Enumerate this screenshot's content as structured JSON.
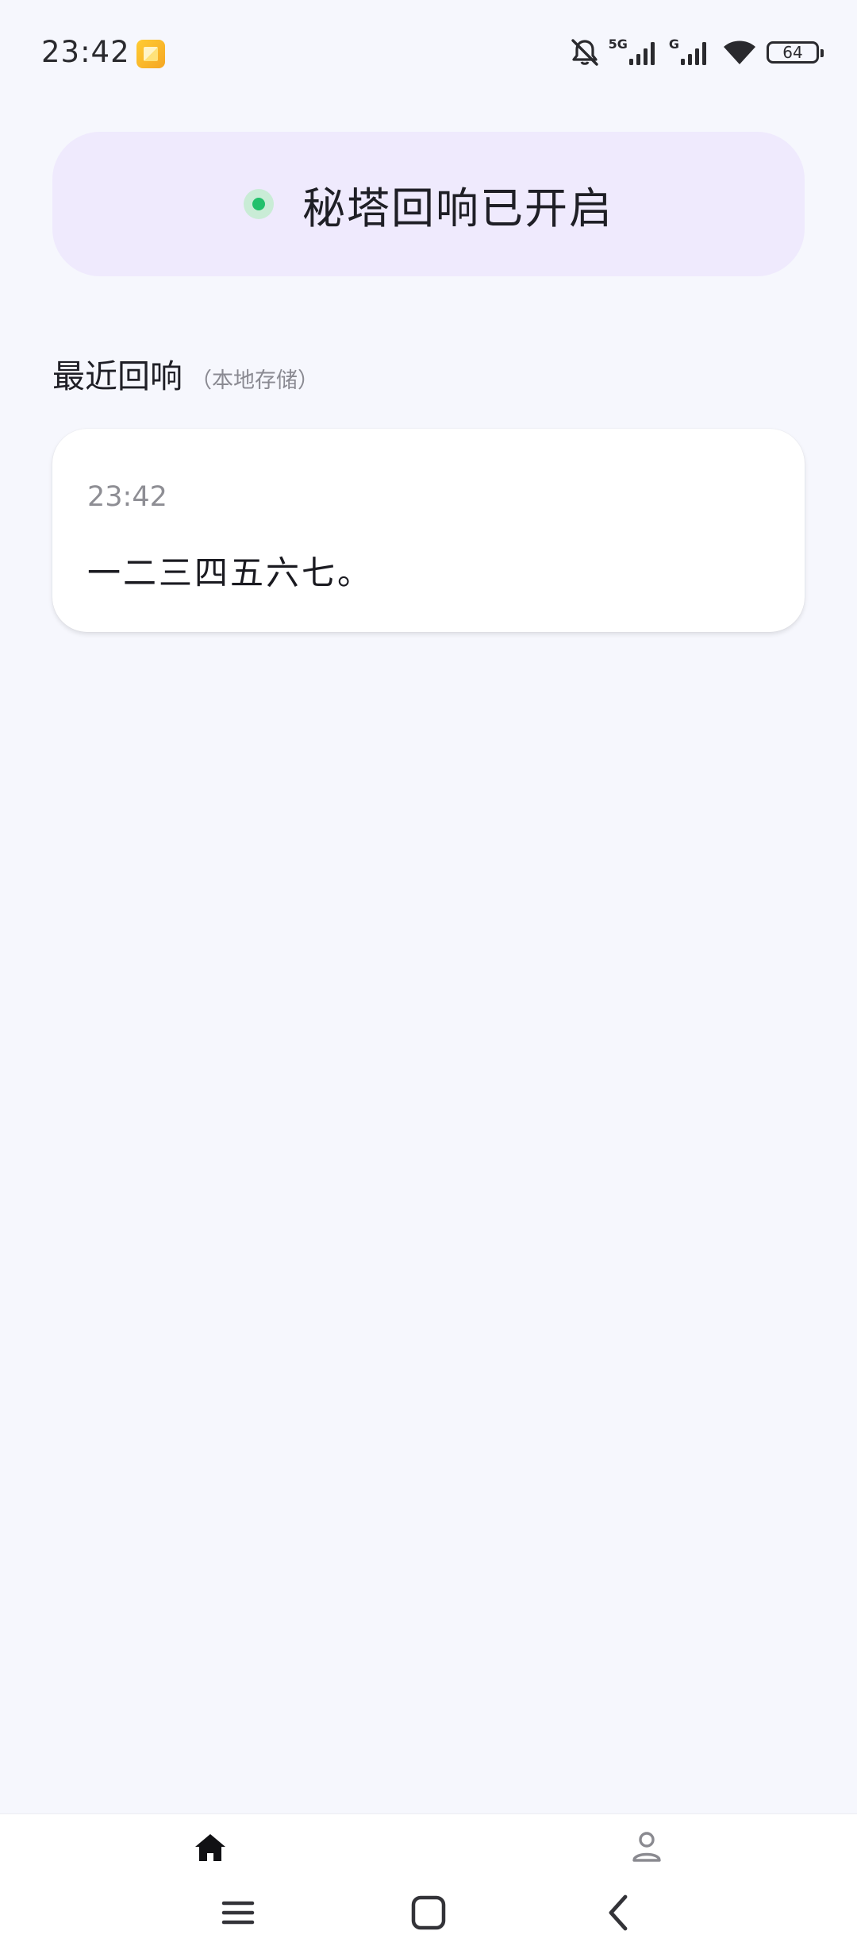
{
  "status_bar": {
    "time": "23:42",
    "network_1": "5G",
    "network_2": "G",
    "battery": "64"
  },
  "status_pill": {
    "text": "秘塔回响已开启",
    "indicator_color": "#22c06b"
  },
  "section": {
    "title": "最近回响",
    "note": "（本地存储）"
  },
  "records": [
    {
      "time": "23:42",
      "text": "一二三四五六七。"
    }
  ],
  "bottom_nav": {
    "items": [
      {
        "icon": "home-icon",
        "active": true
      },
      {
        "icon": "person-icon",
        "active": false
      }
    ]
  },
  "system_nav": [
    "menu-icon",
    "home-square-icon",
    "back-icon"
  ]
}
